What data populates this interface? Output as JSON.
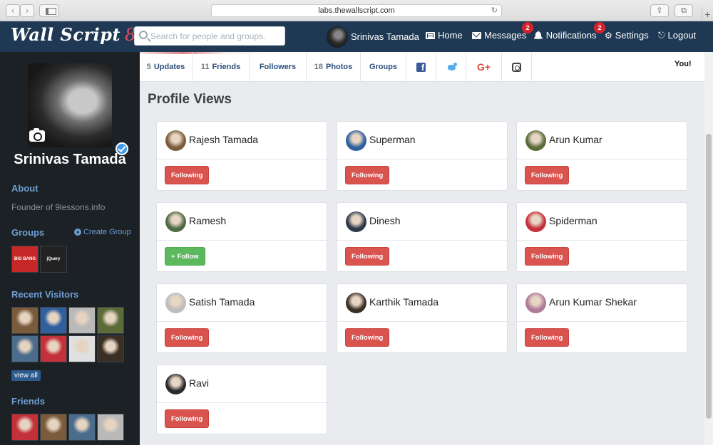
{
  "browser": {
    "url": "labs.thewallscript.com",
    "back_glyph": "‹",
    "forward_glyph": "›",
    "share_glyph": "⇪",
    "tabs_glyph": "⧉",
    "newtab_glyph": "+",
    "reload_glyph": "↻"
  },
  "header": {
    "logo_text": "Wall Script",
    "logo_mark": "8",
    "search_placeholder": "Search for people and groups.",
    "user_name": "Srinivas Tamada",
    "nav": {
      "home": "Home",
      "messages": "Messages",
      "messages_badge": "2",
      "notifications": "Notifications",
      "notifications_badge": "2",
      "settings": "Settings",
      "logout": "Logout"
    },
    "icons": {
      "bell": "🔔",
      "gears": "⚙",
      "logout": "⎋"
    }
  },
  "sidebar": {
    "profile_name": "Srinivas Tamada",
    "about_heading": "About",
    "about_text": "Founder of 9lessons.info",
    "groups_heading": "Groups",
    "create_group": "Create Group",
    "create_group_icon": "+",
    "recent_visitors_heading": "Recent Visitors",
    "view_all": "view all",
    "friends_heading": "Friends",
    "group_thumbs": [
      {
        "label": "Big Bang Theory",
        "text": "BIG BANG THEORY",
        "color": "#c62828"
      },
      {
        "label": "jQuery",
        "text": "jQuery",
        "color": "#222222"
      }
    ],
    "visitor_colors": [
      "#7a5c3c",
      "#2f5f9e",
      "#b9b9b9",
      "#5b6b3a",
      "#4b6c8c",
      "#c4313a",
      "#e0e0e0",
      "#3a2f24"
    ],
    "friend_colors": [
      "#c4313a",
      "#7a5c3c",
      "#4b6c8c",
      "#b9b9b9"
    ]
  },
  "tabs": {
    "updates_count": "5",
    "updates": "Updates",
    "friends_count": "11",
    "friends": "Friends",
    "followers": "Followers",
    "photos_count": "18",
    "photos": "Photos",
    "groups": "Groups",
    "facebook_glyph": "f",
    "googleplus_glyph": "G+",
    "you_label": "You!"
  },
  "main": {
    "section_title": "Profile Views",
    "cards": [
      {
        "name": "Rajesh Tamada",
        "button": "Following",
        "state": "following",
        "avatar_color": "#7a5c3c"
      },
      {
        "name": "Superman",
        "button": "Following",
        "state": "following",
        "avatar_color": "#2f5f9e"
      },
      {
        "name": "Arun Kumar",
        "button": "Following",
        "state": "following",
        "avatar_color": "#5b6b3a"
      },
      {
        "name": "Ramesh",
        "button": "Follow",
        "state": "follow",
        "avatar_color": "#4e6a45"
      },
      {
        "name": "Dinesh",
        "button": "Following",
        "state": "following",
        "avatar_color": "#2e3a4a"
      },
      {
        "name": "Spiderman",
        "button": "Following",
        "state": "following",
        "avatar_color": "#c4313a"
      },
      {
        "name": "Satish Tamada",
        "button": "Following",
        "state": "following",
        "avatar_color": "#bdbdbd"
      },
      {
        "name": "Karthik Tamada",
        "button": "Following",
        "state": "following",
        "avatar_color": "#3a2f24"
      },
      {
        "name": "Arun Kumar Shekar",
        "button": "Following",
        "state": "following",
        "avatar_color": "#b07a9a"
      },
      {
        "name": "Ravi",
        "button": "Following",
        "state": "following",
        "avatar_color": "#2a2a2a"
      }
    ],
    "follow_icon": "+"
  }
}
